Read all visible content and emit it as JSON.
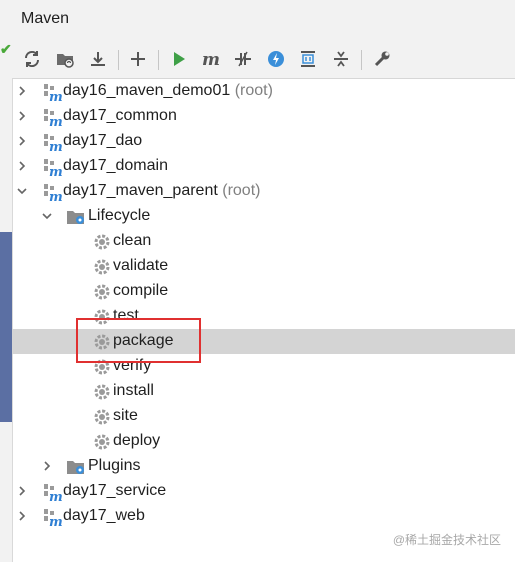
{
  "window": {
    "title": "Maven"
  },
  "toolbar": {
    "buttons": [
      {
        "name": "reload-all-projects-icon"
      },
      {
        "name": "generate-sources-icon"
      },
      {
        "name": "download-sources-icon"
      },
      {
        "name": "add-maven-project-icon"
      },
      {
        "name": "run-maven-build-icon"
      },
      {
        "name": "execute-maven-goal-icon"
      },
      {
        "name": "toggle-offline-mode-icon"
      },
      {
        "name": "skip-tests-icon"
      },
      {
        "name": "show-dependencies-icon"
      },
      {
        "name": "collapse-all-icon"
      },
      {
        "name": "maven-settings-icon"
      }
    ]
  },
  "tree": {
    "projects": [
      {
        "name": "day16_maven_demo01",
        "suffix": "(root)"
      },
      {
        "name": "day17_common"
      },
      {
        "name": "day17_dao"
      },
      {
        "name": "day17_domain"
      },
      {
        "name": "day17_maven_parent",
        "suffix": "(root)"
      },
      {
        "name": "day17_service"
      },
      {
        "name": "day17_web"
      }
    ],
    "lifecycle_label": "Lifecycle",
    "phases": [
      "clean",
      "validate",
      "compile",
      "test",
      "package",
      "verify",
      "install",
      "site",
      "deploy"
    ],
    "plugins_label": "Plugins",
    "selected_phase": "package"
  },
  "watermark": "@稀土掘金技术社区",
  "colors": {
    "accent": "#5b6fa3",
    "selection": "#d4d4d4",
    "highlight_box": "#e03030",
    "run_green": "#3fa047",
    "maven_blue": "#2f7fd3"
  }
}
